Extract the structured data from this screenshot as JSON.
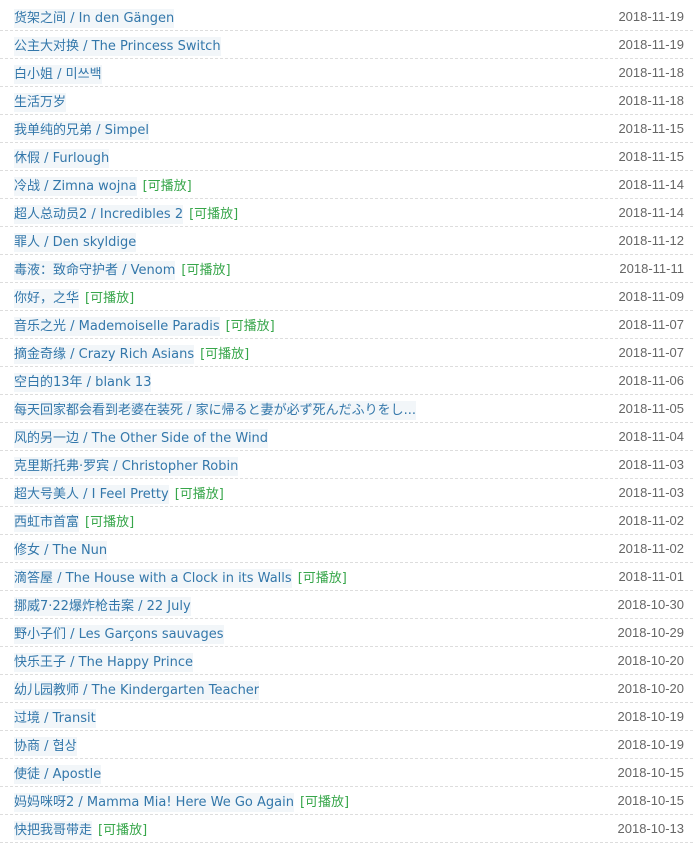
{
  "play_label": "[可播放]",
  "colors": {
    "link": "#3377aa",
    "playable": "#37a64a",
    "date": "#666666",
    "divider": "#dddddd"
  },
  "items": [
    {
      "title": "货架之间 / In den Gängen",
      "date": "2018-11-19",
      "playable": false
    },
    {
      "title": "公主大对换 / The Princess Switch",
      "date": "2018-11-19",
      "playable": false
    },
    {
      "title": "白小姐 / 미쓰백",
      "date": "2018-11-18",
      "playable": false
    },
    {
      "title": "生活万岁",
      "date": "2018-11-18",
      "playable": false
    },
    {
      "title": "我单纯的兄弟 / Simpel",
      "date": "2018-11-15",
      "playable": false
    },
    {
      "title": "休假 / Furlough",
      "date": "2018-11-15",
      "playable": false
    },
    {
      "title": "冷战 / Zimna wojna",
      "date": "2018-11-14",
      "playable": true
    },
    {
      "title": "超人总动员2 / Incredibles 2",
      "date": "2018-11-14",
      "playable": true
    },
    {
      "title": "罪人 / Den skyldige",
      "date": "2018-11-12",
      "playable": false
    },
    {
      "title": "毒液：致命守护者 / Venom",
      "date": "2018-11-11",
      "playable": true
    },
    {
      "title": "你好，之华",
      "date": "2018-11-09",
      "playable": true
    },
    {
      "title": "音乐之光 / Mademoiselle Paradis",
      "date": "2018-11-07",
      "playable": true
    },
    {
      "title": "摘金奇缘 / Crazy Rich Asians",
      "date": "2018-11-07",
      "playable": true
    },
    {
      "title": "空白的13年 / blank 13",
      "date": "2018-11-06",
      "playable": false
    },
    {
      "title": "每天回家都会看到老婆在装死 / 家に帰ると妻が必ず死んだふりをし...",
      "date": "2018-11-05",
      "playable": false
    },
    {
      "title": "风的另一边 / The Other Side of the Wind",
      "date": "2018-11-04",
      "playable": false
    },
    {
      "title": "克里斯托弗·罗宾 / Christopher Robin",
      "date": "2018-11-03",
      "playable": false
    },
    {
      "title": "超大号美人 / I Feel Pretty",
      "date": "2018-11-03",
      "playable": true
    },
    {
      "title": "西虹市首富",
      "date": "2018-11-02",
      "playable": true
    },
    {
      "title": "修女 / The Nun",
      "date": "2018-11-02",
      "playable": false
    },
    {
      "title": "滴答屋 / The House with a Clock in its Walls",
      "date": "2018-11-01",
      "playable": true
    },
    {
      "title": "挪威7·22爆炸枪击案 / 22 July",
      "date": "2018-10-30",
      "playable": false
    },
    {
      "title": "野小子们 / Les Garçons sauvages",
      "date": "2018-10-29",
      "playable": false
    },
    {
      "title": "快乐王子 / The Happy Prince",
      "date": "2018-10-20",
      "playable": false
    },
    {
      "title": "幼儿园教师 / The Kindergarten Teacher",
      "date": "2018-10-20",
      "playable": false
    },
    {
      "title": "过境 / Transit",
      "date": "2018-10-19",
      "playable": false
    },
    {
      "title": "协商 / 협상",
      "date": "2018-10-19",
      "playable": false
    },
    {
      "title": "使徒 / Apostle",
      "date": "2018-10-15",
      "playable": false
    },
    {
      "title": "妈妈咪呀2 / Mamma Mia! Here We Go Again",
      "date": "2018-10-15",
      "playable": true
    },
    {
      "title": "快把我哥带走",
      "date": "2018-10-13",
      "playable": true
    }
  ]
}
